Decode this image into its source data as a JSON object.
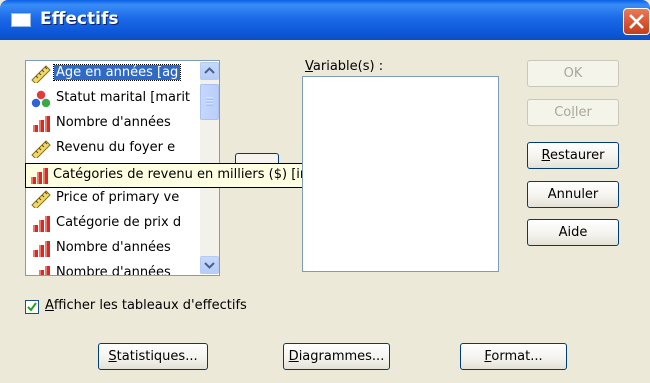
{
  "window": {
    "title": "Effectifs",
    "title_icon": "window-icon",
    "close_icon": "close-icon"
  },
  "source_list": {
    "items": [
      {
        "label": "Age en années [ag",
        "icon": "scale-ruler-icon",
        "selected": true
      },
      {
        "label": "Statut marital [marit",
        "icon": "nominal-icon",
        "selected": false
      },
      {
        "label": "Nombre d'années",
        "icon": "ordinal-bars-icon",
        "selected": false
      },
      {
        "label": "Revenu du foyer e",
        "icon": "scale-ruler-icon",
        "selected": false
      },
      {
        "label": "Catégories de revenu en milliers ($) [inccat]",
        "icon": "ordinal-bars-icon",
        "selected": false
      },
      {
        "label": "Price of primary ve",
        "icon": "scale-ruler-icon",
        "selected": false
      },
      {
        "label": "Catégorie de prix d",
        "icon": "ordinal-bars-icon",
        "selected": false
      },
      {
        "label": "Nombre d'années",
        "icon": "ordinal-bars-icon",
        "selected": false
      },
      {
        "label": "Nombre d'années",
        "icon": "ordinal-bars-icon",
        "selected": false
      }
    ]
  },
  "tooltip": {
    "label": "Catégories de revenu en milliers ($) [inccat]",
    "icon": "ordinal-bars-icon"
  },
  "target": {
    "label": "Variable(s) :"
  },
  "buttons": {
    "ok": "OK",
    "paste": "Coller",
    "reset": "Restaurer",
    "cancel": "Annuler",
    "help": "Aide",
    "statistics": "Statistiques...",
    "charts": "Diagrammes...",
    "format": "Format..."
  },
  "checkbox": {
    "label": "Afficher les tableaux d'effectifs",
    "checked": true
  },
  "colors": {
    "titlebar": "#0a5fe6",
    "selection": "#316ac5",
    "tooltip_bg": "#ffffe1",
    "dialog_bg": "#ece9d8"
  }
}
